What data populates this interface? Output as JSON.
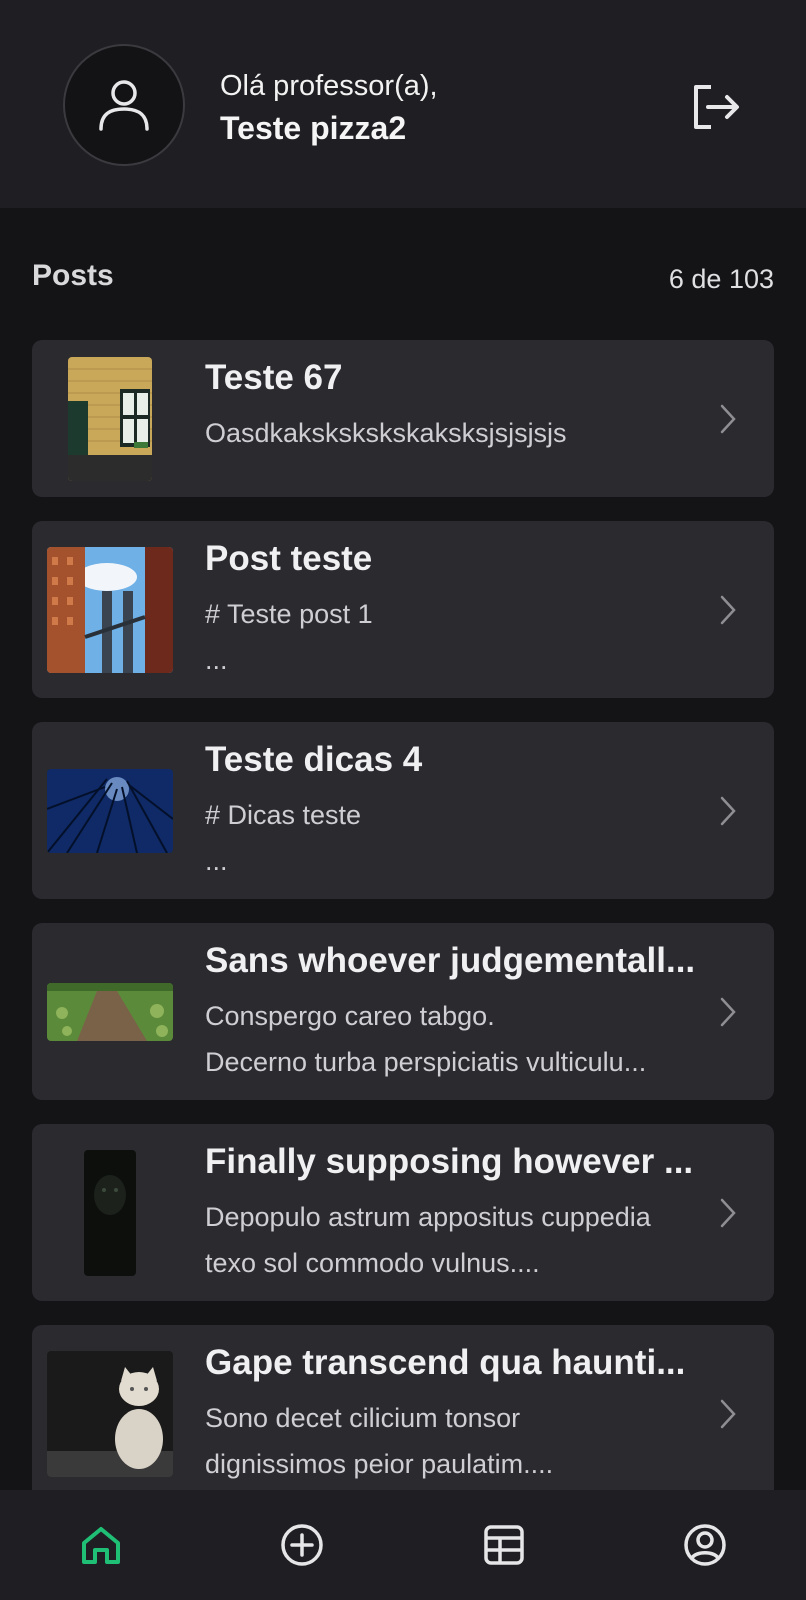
{
  "header": {
    "greeting": "Olá professor(a),",
    "user_name": "Teste pizza2",
    "avatar_icon": "user-icon",
    "logout_icon": "logout-icon"
  },
  "posts_section": {
    "title": "Posts",
    "count_text": "6 de 103"
  },
  "posts": [
    {
      "title": "Teste 67",
      "line1": "Oasdkakskskskskaksksjsjsjsjs",
      "line2": "",
      "thumb": "building-door-photo"
    },
    {
      "title": "Post teste",
      "line1": "# Teste post 1",
      "line2": "...",
      "thumb": "bridge-city-photo"
    },
    {
      "title": "Teste dicas 4",
      "line1": "# Dicas teste",
      "line2": "...",
      "thumb": "forest-night-photo"
    },
    {
      "title": "Sans whoever judgementall...",
      "line1": "Conspergo careo tabgo.",
      "line2": "Decerno turba perspiciatis vulticulu...",
      "thumb": "grass-path-photo"
    },
    {
      "title": "Finally supposing however ...",
      "line1": "Depopulo astrum appositus cuppedia",
      "line2": "texo sol commodo vulnus....",
      "thumb": "dark-animal-photo"
    },
    {
      "title": "Gape transcend qua haunti...",
      "line1": "Sono decet cilicium tonsor",
      "line2": "dignissimos peior paulatim....",
      "thumb": "cat-photo"
    }
  ],
  "colors": {
    "accent": "#1fbf75",
    "background": "#141417",
    "card": "#2a2a2f",
    "header": "#1f1f23"
  },
  "bottom_nav": [
    {
      "name": "home-icon",
      "active": true
    },
    {
      "name": "add-circle-icon",
      "active": false
    },
    {
      "name": "table-icon",
      "active": false
    },
    {
      "name": "profile-icon",
      "active": false
    }
  ]
}
